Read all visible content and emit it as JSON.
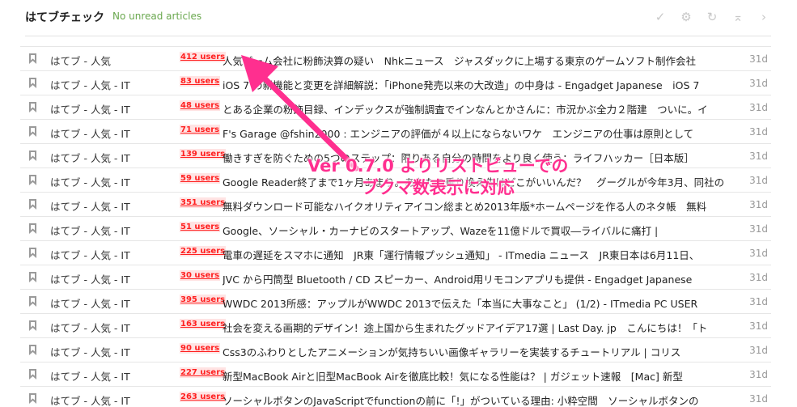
{
  "header": {
    "title": "はてブチェック",
    "status": "No unread articles",
    "tools": [
      {
        "name": "check-icon",
        "glyph": "✓"
      },
      {
        "name": "gear-icon",
        "glyph": "⚙"
      },
      {
        "name": "refresh-icon",
        "glyph": "↻"
      },
      {
        "name": "collapse-icon",
        "glyph": "⌅"
      },
      {
        "name": "next-icon",
        "glyph": "›"
      }
    ]
  },
  "annotation": {
    "line1": "Ver 0.7.0 よりリストビューでの",
    "line2": "ブクマ数表示に対応",
    "color": "#ff2f8f"
  },
  "rows": [
    {
      "feed": "はてブ - 人気",
      "users": "412 users",
      "headline": "人気ゲーム会社に粉飾決算の疑い　Nhkニュース　ジャスダックに上場する東京のゲームソフト制作会社",
      "age": "31d"
    },
    {
      "feed": "はてブ - 人気 - IT",
      "users": "83 users",
      "headline": "iOS 7 の新機能と変更を詳細解説：「iPhone発売以来の大改造」の中身は - Engadget Japanese　iOS 7",
      "age": "31d"
    },
    {
      "feed": "はてブ - 人気 - IT",
      "users": "48 users",
      "headline": "とある企業の粉飾目録、インデックスが強制調査でインなんとかさんに：市況かぶ全力２階建　ついに。イ",
      "age": "31d"
    },
    {
      "feed": "はてブ - 人気 - IT",
      "users": "71 users",
      "headline": "F's Garage @fshin2000 : エンジニアの評価が４以上にならないワケ　エンジニアの仕事は原則として",
      "age": "31d"
    },
    {
      "feed": "はてブ - 人気 - IT",
      "users": "139 users",
      "headline": "働きすぎを防ぐための5つのステップ：限りある自分の時間をより良く使う：ライフハッカー［日本版］",
      "age": "31d"
    },
    {
      "feed": "はてブ - 人気 - IT",
      "users": "59 users",
      "headline": "Google Reader終了まで1ヶ月あまり。あなたの乗り換え先はどこがいいんだ？　グーグルが今年3月、同社の",
      "age": "31d"
    },
    {
      "feed": "はてブ - 人気 - IT",
      "users": "351 users",
      "headline": "無料ダウンロード可能なハイクオリティアイコン総まとめ2013年版*ホームページを作る人のネタ帳　無料",
      "age": "31d"
    },
    {
      "feed": "はてブ - 人気 - IT",
      "users": "51 users",
      "headline": "Google、ソーシャル・カーナビのスタートアップ、Wazeを11億ドルで買収―ライバルに痛打 |",
      "age": "31d"
    },
    {
      "feed": "はてブ - 人気 - IT",
      "users": "225 users",
      "headline": "電車の遅延をスマホに通知　JR東「運行情報プッシュ通知」 - ITmedia ニュース　JR東日本は6月11日、",
      "age": "31d"
    },
    {
      "feed": "はてブ - 人気 - IT",
      "users": "30 users",
      "headline": "JVC から円筒型 Bluetooth / CD スピーカー、Android用リモコンアプリも提供 - Engadget Japanese",
      "age": "31d"
    },
    {
      "feed": "はてブ - 人気 - IT",
      "users": "395 users",
      "headline": "WWDC 2013所感：アップルがWWDC 2013で伝えた「本当に大事なこと」 (1/2) - ITmedia PC USER",
      "age": "31d"
    },
    {
      "feed": "はてブ - 人気 - IT",
      "users": "163 users",
      "headline": "社会を変える画期的デザイン！途上国から生まれたグッドアイデア17選 | Last Day. jp　こんにちは！「ト",
      "age": "31d"
    },
    {
      "feed": "はてブ - 人気 - IT",
      "users": "90 users",
      "headline": "Css3のふわりとしたアニメーションが気持ちいい画像ギャラリーを実装するチュートリアル | コリス",
      "age": "31d"
    },
    {
      "feed": "はてブ - 人気 - IT",
      "users": "227 users",
      "headline": "新型MacBook Airと旧型MacBook Airを徹底比較！気になる性能は？ | ガジェット速報　[Mac] 新型",
      "age": "31d"
    },
    {
      "feed": "はてブ - 人気 - IT",
      "users": "263 users",
      "headline": "ソーシャルボタンのJavaScriptでfunctionの前に「!」がついている理由: 小粋空間　ソーシャルボタンの",
      "age": "31d"
    }
  ]
}
